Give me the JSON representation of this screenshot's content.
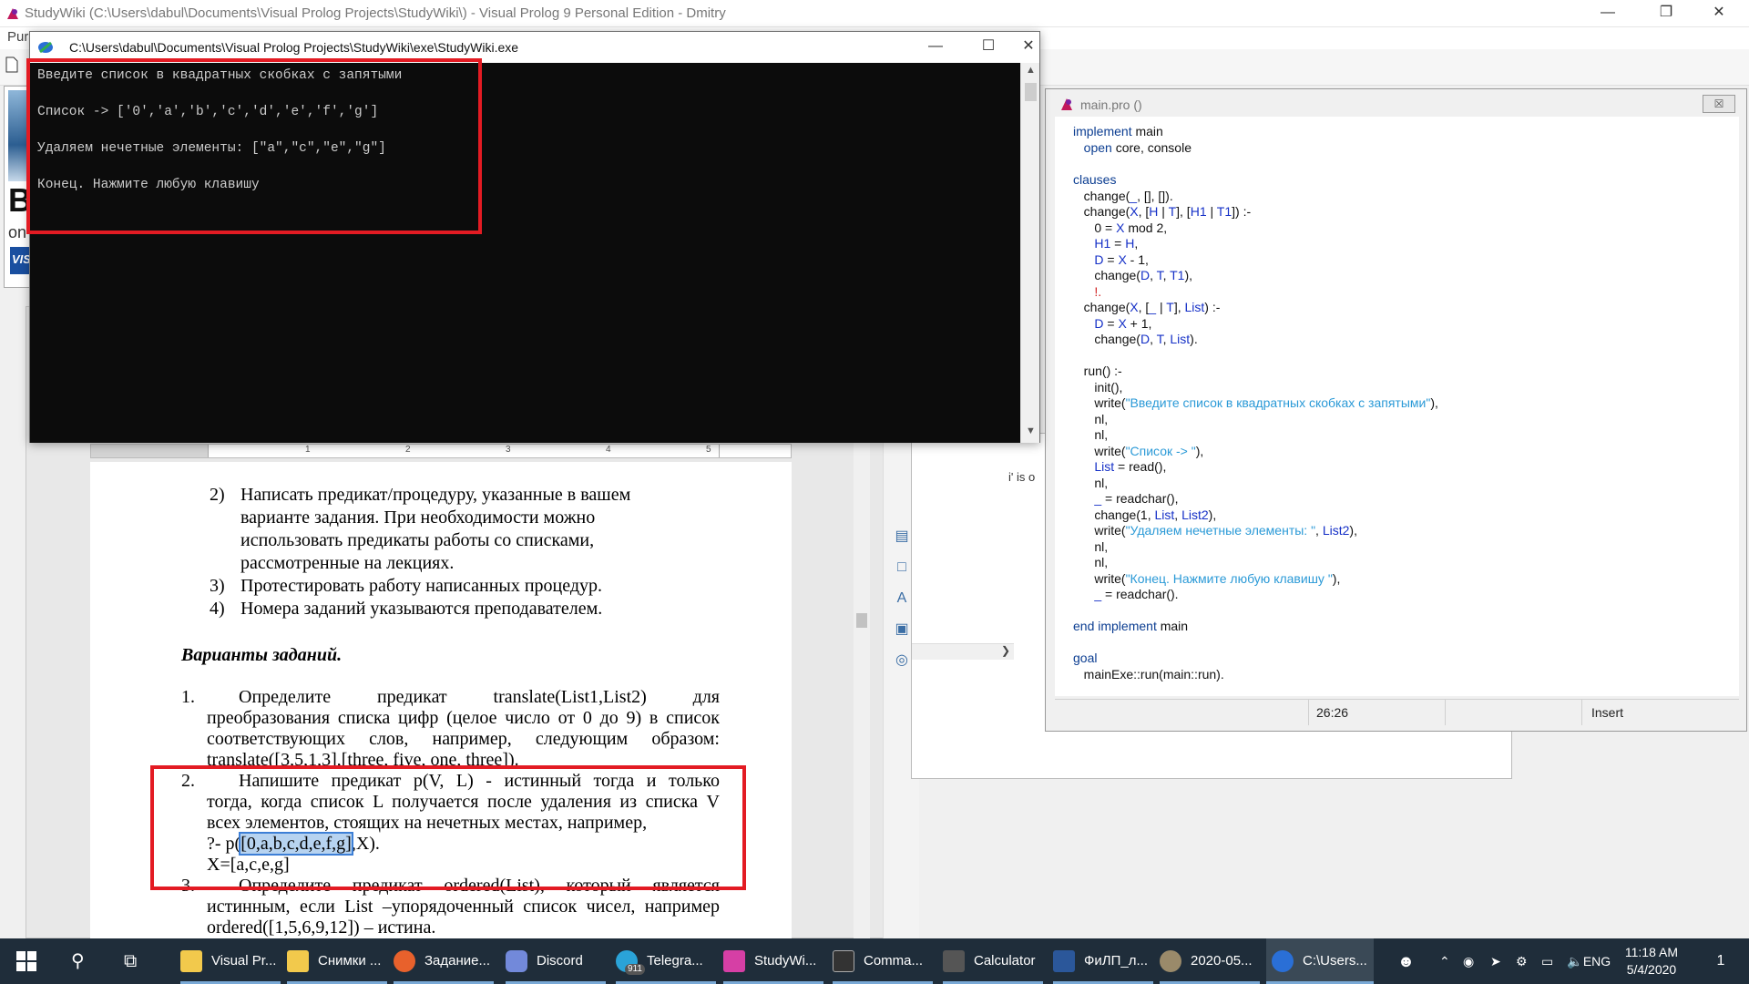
{
  "ide": {
    "title": "StudyWiki (C:\\Users\\dabul\\Documents\\Visual Prolog Projects\\StudyWiki\\) - Visual Prolog 9 Personal Edition - Dmitry",
    "menu_fragment": "Purc",
    "ad": {
      "big_text": "Bu",
      "sub_text": "on",
      "card_text": "VIS"
    }
  },
  "console": {
    "title": "C:\\Users\\dabul\\Documents\\Visual Prolog Projects\\StudyWiki\\exe\\StudyWiki.exe",
    "lines": [
      "Введите список в квадратных скобках с запятыми",
      "Список -> ['0','a','b','c','d','e','f','g']",
      "Удаляем нечетные элементы: [\"a\",\"c\",\"e\",\"g\"]",
      "Конец. Нажмите любую клавишу"
    ]
  },
  "editor": {
    "title": "main.pro ()",
    "close_label": "☒",
    "code": {
      "l1a": "implement",
      "l1b": " main",
      "l2a": "   open",
      "l2b": " core, console",
      "l4": "clauses",
      "l5a": "   change(",
      "l5b": "_",
      "l5c": ", [], []).",
      "l6a": "   change(",
      "l6b": "X",
      "l6c": ", [",
      "l6d": "H",
      "l6e": " | ",
      "l6f": "T",
      "l6g": "], [",
      "l6h": "H1",
      "l6i": " | ",
      "l6j": "T1",
      "l6k": "]) :-",
      "l7a": "      0 = ",
      "l7b": "X",
      "l7c": " mod 2,",
      "l8a": "      ",
      "l8b": "H1",
      "l8c": " = ",
      "l8d": "H",
      "l8e": ",",
      "l9a": "      ",
      "l9b": "D",
      "l9c": " = ",
      "l9d": "X",
      "l9e": " - 1,",
      "l10a": "      change(",
      "l10b": "D",
      "l10c": ", ",
      "l10d": "T",
      "l10e": ", ",
      "l10f": "T1",
      "l10g": "),",
      "l11a": "      ",
      "l11b": "!.",
      "l12a": "   change(",
      "l12b": "X",
      "l12c": ", [",
      "l12d": "_",
      "l12e": " | ",
      "l12f": "T",
      "l12g": "], ",
      "l12h": "List",
      "l12i": ") :-",
      "l13a": "      ",
      "l13b": "D",
      "l13c": " = ",
      "l13d": "X",
      "l13e": " + 1,",
      "l14a": "      change(",
      "l14b": "D",
      "l14c": ", ",
      "l14d": "T",
      "l14e": ", ",
      "l14f": "List",
      "l14g": ").",
      "l16": "   run() :-",
      "l17": "      init(),",
      "l18a": "      write(",
      "l18b": "\"Введите список в квадратных скобках с запятыми\"",
      "l18c": "),",
      "l19": "      nl,",
      "l20": "      nl,",
      "l21a": "      write(",
      "l21b": "\"Список -> \"",
      "l21c": "),",
      "l22a": "      ",
      "l22b": "List",
      "l22c": " = read(),",
      "l23": "      nl,",
      "l24a": "      ",
      "l24b": "_",
      "l24c": " = readchar(),",
      "l25a": "      change(1, ",
      "l25b": "List",
      "l25c": ", ",
      "l25d": "List2",
      "l25e": "),",
      "l26a": "      write(",
      "l26b": "\"Удаляем нечетные элементы: \"",
      "l26c": ", ",
      "l26d": "List2",
      "l26e": "),",
      "l27": "      nl,",
      "l28": "      nl,",
      "l29a": "      write(",
      "l29b": "\"Конец. Нажмите любую клавишу \"",
      "l29c": "),",
      "l30a": "      ",
      "l30b": "_",
      "l30c": " = readchar().",
      "l32a": "end implement",
      "l32b": " main",
      "l34": "goal",
      "l35": "   mainExe::run(main::run)."
    },
    "status": {
      "position": "26:26",
      "mode": "Insert"
    }
  },
  "messages": {
    "fragment": "i' is o"
  },
  "word": {
    "ruler_numbers": [
      "1",
      "2",
      "3",
      "4",
      "5"
    ],
    "list_items": [
      {
        "num": "2)",
        "text": "Написать предикат/процедуру, указанные в вашем"
      },
      {
        "num": "",
        "text": "варианте задания. При необходимости можно"
      },
      {
        "num": "",
        "text": "использовать предикаты работы со списками,"
      },
      {
        "num": "",
        "text": "рассмотренные на лекциях."
      },
      {
        "num": "3)",
        "text": "Протестировать работу написанных процедур."
      },
      {
        "num": "4)",
        "text": "Номера заданий указываются преподавателем."
      }
    ],
    "heading": "Варианты заданий.",
    "task1": {
      "num": "1.",
      "line1": "Определите предикат translate(List1,List2) для",
      "line2": "преобразования списка цифр (целое число от 0 до 9) в список",
      "line3": "соответствующих слов, например, следующим образом:",
      "line4": "translate([3,5,1,3],[three, five, one, three])."
    },
    "task2": {
      "num": "2.",
      "line1": "Напишите предикат p(V, L) - истинный тогда и только",
      "line2": "тогда, когда список L получается после удаления из списка V",
      "line3": "всех элементов, стоящих на нечетных местах, например,",
      "line4a": "?- p(",
      "line4b": "[0,a,b,c,d,e,f,g]",
      "line4c": ",X).",
      "line5": "X=[a,c,e,g]"
    },
    "task3": {
      "num": "3.",
      "line1": "Определите предикат ordered(List), который является",
      "line2": "истинным, если List –упорядоченный список чисел, например",
      "line3": "ordered([1,5,6,9,12]) – истина."
    }
  },
  "taskbar": {
    "apps": [
      {
        "label": "Visual Pr...",
        "color": "#f2c94c"
      },
      {
        "label": "Снимки ...",
        "color": "#f2c94c"
      },
      {
        "label": "Задание...",
        "color": "#e8612c"
      },
      {
        "label": "Discord",
        "color": "#7289da"
      },
      {
        "label": "Telegra...",
        "color": "#2aa3d8"
      },
      {
        "label": "StudyWi...",
        "color": "#d63fa5"
      },
      {
        "label": "Comma...",
        "color": "#333333"
      },
      {
        "label": "Calculator",
        "color": "#555555"
      },
      {
        "label": "ФиЛП_л...",
        "color": "#2b579a"
      },
      {
        "label": "2020-05...",
        "color": "#9a8a6a"
      },
      {
        "label": "C:\\Users...",
        "color": "#2a6fd6"
      }
    ],
    "telegram_badge": "911",
    "language": "ENG",
    "time": "11:18 AM",
    "date": "5/4/2020",
    "notification_count": "1"
  }
}
